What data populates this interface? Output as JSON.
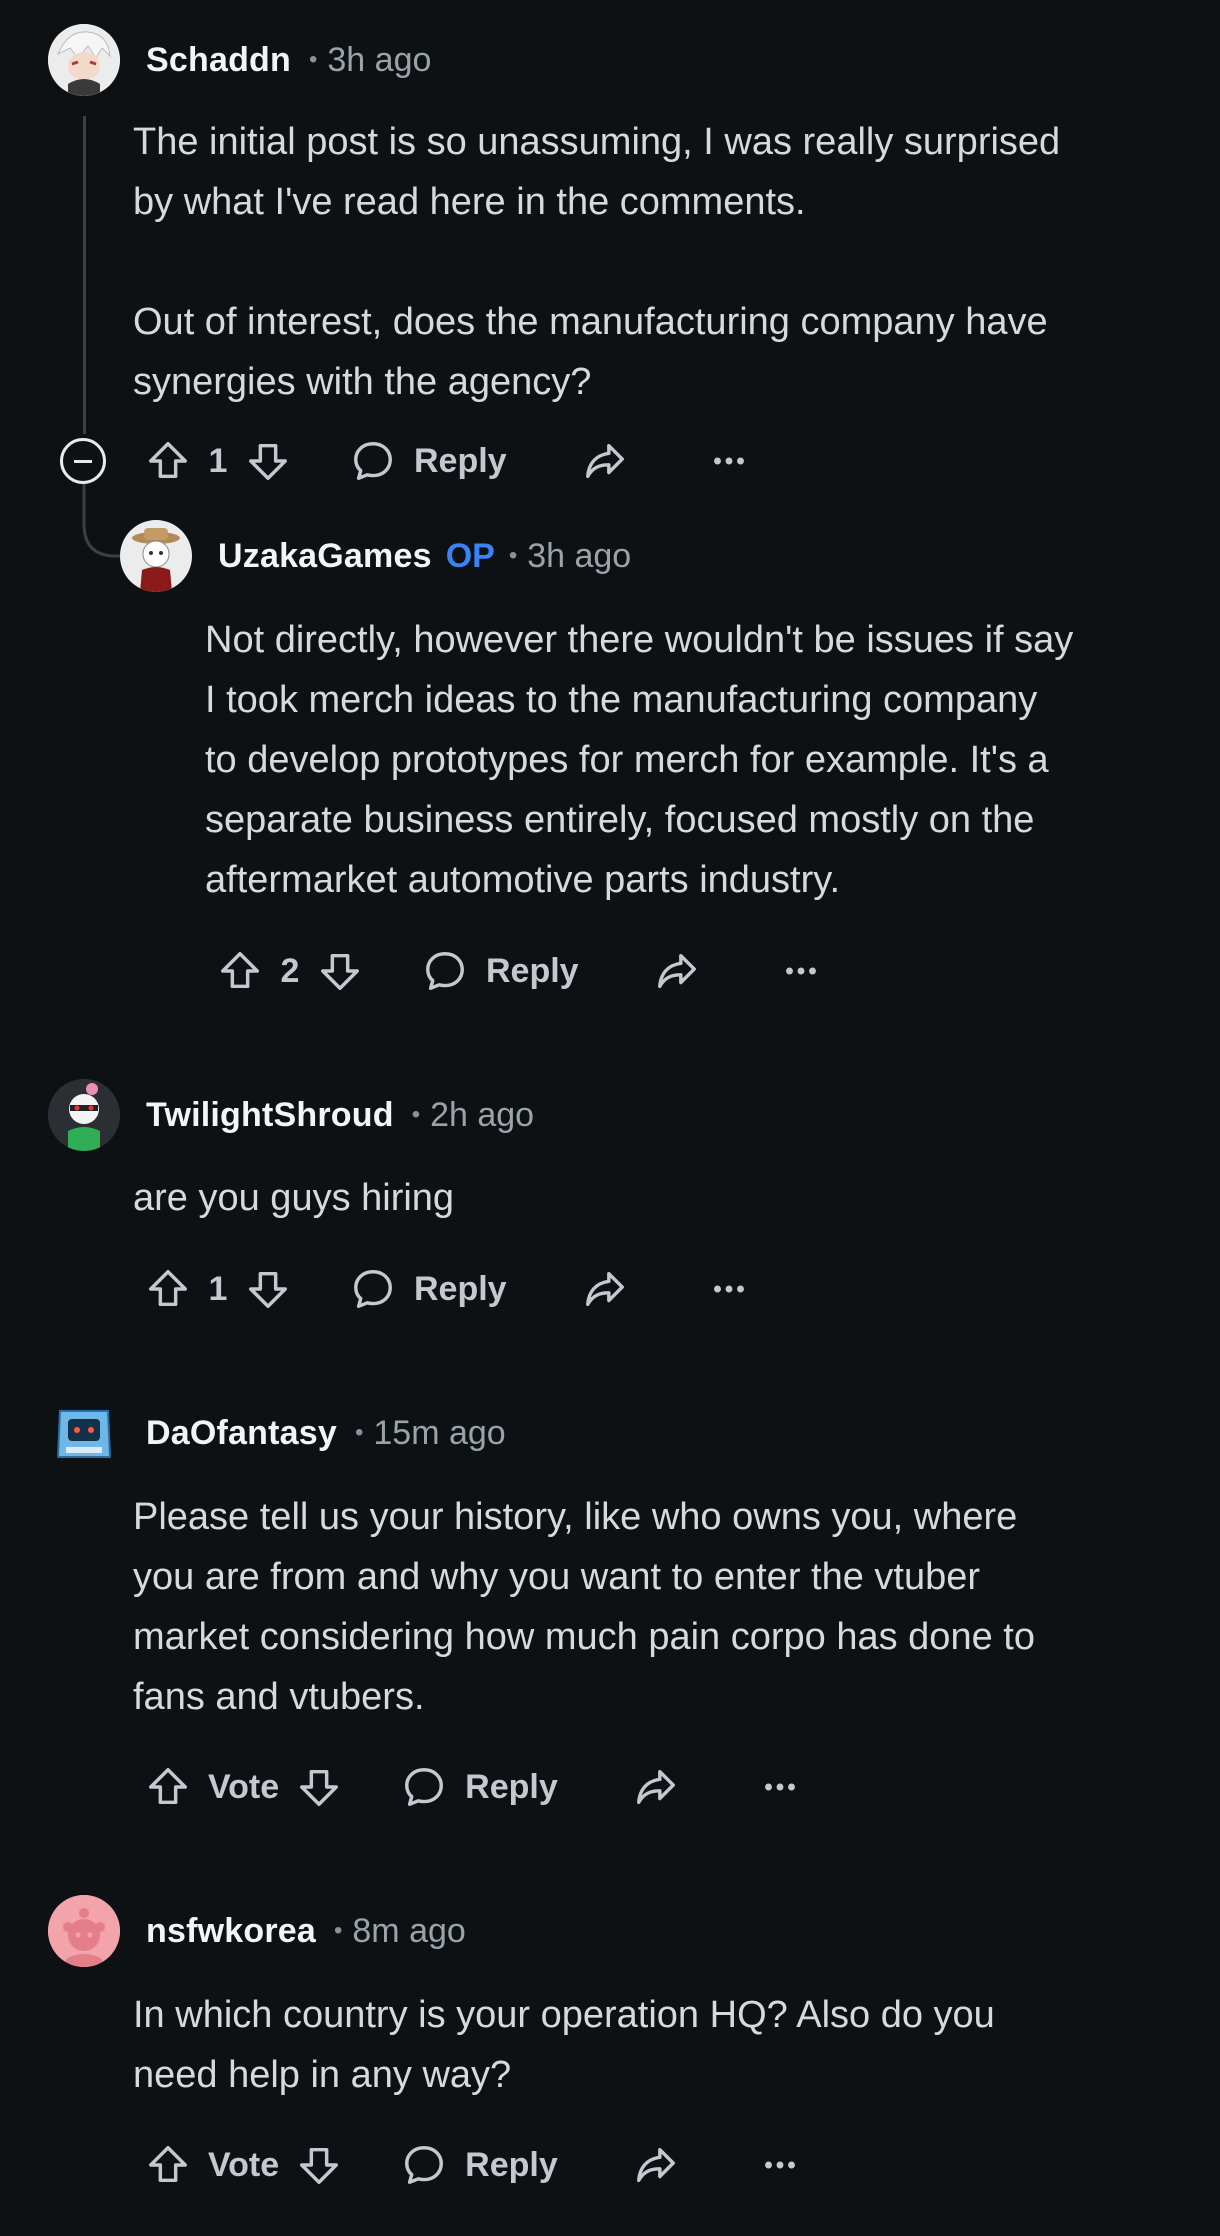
{
  "comments": [
    {
      "author": "Schaddn",
      "time": "3h ago",
      "body": "The initial post is so unassuming, I was really surprised\nby what I've read here in the comments.\n\nOut of interest, does the manufacturing company have\nsynergies with the agency?",
      "votes": "1",
      "reply_label": "Reply"
    },
    {
      "author": "UzakaGames",
      "op_badge": "OP",
      "time": "3h ago",
      "body": "Not directly, however there wouldn't be issues if say\nI took merch ideas to the manufacturing company\nto develop prototypes for merch for example. It's a\nseparate business entirely, focused mostly on the\naftermarket automotive parts industry.",
      "votes": "2",
      "reply_label": "Reply"
    },
    {
      "author": "TwilightShroud",
      "time": "2h ago",
      "body": "are you guys hiring",
      "votes": "1",
      "reply_label": "Reply"
    },
    {
      "author": "DaOfantasy",
      "time": "15m ago",
      "body": "Please tell us your history, like who owns you, where\nyou are from and why you want to enter the vtuber\nmarket considering how much pain corpo has done to\nfans and vtubers.",
      "votes": "Vote",
      "reply_label": "Reply"
    },
    {
      "author": "nsfwkorea",
      "time": "8m ago",
      "body": "In which country is your operation HQ? Also do you\nneed help in any way?",
      "votes": "Vote",
      "reply_label": "Reply"
    }
  ],
  "dot": "•",
  "colors": {
    "background": "#0e1113",
    "text": "#d7dadc",
    "op": "#3b82f6",
    "muted": "#9aa3a8"
  },
  "icons": [
    "upvote-icon",
    "downvote-icon",
    "comment-bubble-icon",
    "share-icon",
    "more-icon",
    "collapse-icon"
  ]
}
